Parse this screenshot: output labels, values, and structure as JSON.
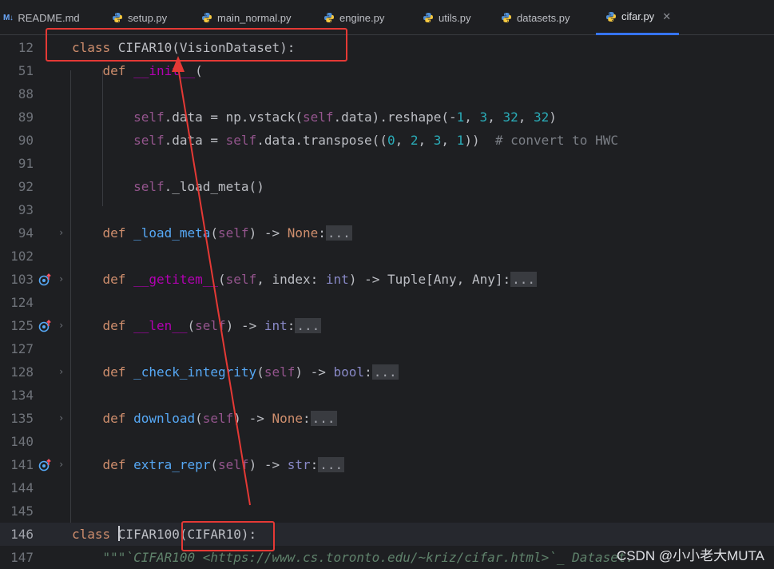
{
  "tabs": [
    {
      "label": "README.md",
      "icon": "markdown-icon",
      "icon_text": "M↓"
    },
    {
      "label": "setup.py",
      "icon": "python-icon"
    },
    {
      "label": "main_normal.py",
      "icon": "python-icon"
    },
    {
      "label": "engine.py",
      "icon": "python-icon"
    },
    {
      "label": "utils.py",
      "icon": "python-icon"
    },
    {
      "label": "datasets.py",
      "icon": "python-icon"
    },
    {
      "label": "cifar.py",
      "icon": "python-icon",
      "active": true,
      "close": "✕"
    }
  ],
  "lines": [
    {
      "n": "12",
      "parts": [
        [
          "kw",
          "class "
        ],
        [
          "",
          "CIFAR10(VisionDataset):"
        ]
      ]
    },
    {
      "n": "51",
      "parts": [
        [
          "",
          "    "
        ],
        [
          "kw",
          "def "
        ],
        [
          "dunder",
          "__init__"
        ],
        [
          "",
          "("
        ]
      ]
    },
    {
      "n": "88",
      "parts": []
    },
    {
      "n": "89",
      "parts": [
        [
          "",
          "        "
        ],
        [
          "sf",
          "self"
        ],
        [
          "",
          ".data = np.vstack("
        ],
        [
          "sf",
          "self"
        ],
        [
          "",
          ".data).reshape(-"
        ],
        [
          "num",
          "1"
        ],
        [
          "",
          ", "
        ],
        [
          "num",
          "3"
        ],
        [
          "",
          ", "
        ],
        [
          "num",
          "32"
        ],
        [
          "",
          ", "
        ],
        [
          "num",
          "32"
        ],
        [
          "",
          ")"
        ]
      ]
    },
    {
      "n": "90",
      "parts": [
        [
          "",
          "        "
        ],
        [
          "sf",
          "self"
        ],
        [
          "",
          ".data = "
        ],
        [
          "sf",
          "self"
        ],
        [
          "",
          ".data.transpose(("
        ],
        [
          "num",
          "0"
        ],
        [
          "",
          ", "
        ],
        [
          "num",
          "2"
        ],
        [
          "",
          ", "
        ],
        [
          "num",
          "3"
        ],
        [
          "",
          ", "
        ],
        [
          "num",
          "1"
        ],
        [
          "",
          "))  "
        ],
        [
          "cm",
          "# convert to HWC"
        ]
      ]
    },
    {
      "n": "91",
      "parts": []
    },
    {
      "n": "92",
      "parts": [
        [
          "",
          "        "
        ],
        [
          "sf",
          "self"
        ],
        [
          "",
          "._load_meta()"
        ]
      ]
    },
    {
      "n": "93",
      "parts": []
    },
    {
      "n": "94",
      "fold": "›",
      "parts": [
        [
          "",
          "    "
        ],
        [
          "kw",
          "def "
        ],
        [
          "fn",
          "_load_meta"
        ],
        [
          "",
          "("
        ],
        [
          "sf",
          "self"
        ],
        [
          "",
          ") -> "
        ],
        [
          "kw",
          "None"
        ],
        [
          "",
          ":"
        ],
        [
          "fold-box",
          "..."
        ]
      ]
    },
    {
      "n": "102",
      "parts": []
    },
    {
      "n": "103",
      "fold": "›",
      "override": true,
      "parts": [
        [
          "",
          "    "
        ],
        [
          "kw",
          "def "
        ],
        [
          "dunder",
          "__getitem__"
        ],
        [
          "",
          "("
        ],
        [
          "sf",
          "self"
        ],
        [
          "",
          ", index: "
        ],
        [
          "bi",
          "int"
        ],
        [
          "",
          ") -> Tuple[Any, Any]:"
        ],
        [
          "fold-box",
          "..."
        ]
      ]
    },
    {
      "n": "124",
      "parts": []
    },
    {
      "n": "125",
      "fold": "›",
      "override": true,
      "parts": [
        [
          "",
          "    "
        ],
        [
          "kw",
          "def "
        ],
        [
          "dunder",
          "__len__"
        ],
        [
          "",
          "("
        ],
        [
          "sf",
          "self"
        ],
        [
          "",
          ") -> "
        ],
        [
          "bi",
          "int"
        ],
        [
          "",
          ":"
        ],
        [
          "fold-box",
          "..."
        ]
      ]
    },
    {
      "n": "127",
      "parts": []
    },
    {
      "n": "128",
      "fold": "›",
      "parts": [
        [
          "",
          "    "
        ],
        [
          "kw",
          "def "
        ],
        [
          "fn",
          "_check_integrity"
        ],
        [
          "",
          "("
        ],
        [
          "sf",
          "self"
        ],
        [
          "",
          ") -> "
        ],
        [
          "bi",
          "bool"
        ],
        [
          "",
          ":"
        ],
        [
          "fold-box",
          "..."
        ]
      ]
    },
    {
      "n": "134",
      "parts": []
    },
    {
      "n": "135",
      "fold": "›",
      "parts": [
        [
          "",
          "    "
        ],
        [
          "kw",
          "def "
        ],
        [
          "fn",
          "download"
        ],
        [
          "",
          "("
        ],
        [
          "sf",
          "self"
        ],
        [
          "",
          ") -> "
        ],
        [
          "kw",
          "None"
        ],
        [
          "",
          ":"
        ],
        [
          "fold-box",
          "..."
        ]
      ]
    },
    {
      "n": "140",
      "parts": []
    },
    {
      "n": "141",
      "fold": "›",
      "override": true,
      "parts": [
        [
          "",
          "    "
        ],
        [
          "kw",
          "def "
        ],
        [
          "fn",
          "extra_repr"
        ],
        [
          "",
          "("
        ],
        [
          "sf",
          "self"
        ],
        [
          "",
          ") -> "
        ],
        [
          "bi",
          "str"
        ],
        [
          "",
          ":"
        ],
        [
          "fold-box",
          "..."
        ]
      ]
    },
    {
      "n": "144",
      "parts": []
    },
    {
      "n": "145",
      "parts": []
    },
    {
      "n": "146",
      "current": true,
      "caret": true,
      "parts": [
        [
          "kw",
          "class "
        ],
        [
          "",
          "CIFAR100(CIFAR10):"
        ]
      ]
    },
    {
      "n": "147",
      "parts": [
        [
          "",
          "    "
        ],
        [
          "doc",
          "\"\"\"`CIFAR100 <https://www.cs.toronto.edu/~kriz/cifar.html>`_ Dataset."
        ]
      ]
    }
  ],
  "watermark": "CSDN @小小老大MUTA",
  "colors": {
    "annotation": "#e53935",
    "accent": "#3574f0"
  }
}
